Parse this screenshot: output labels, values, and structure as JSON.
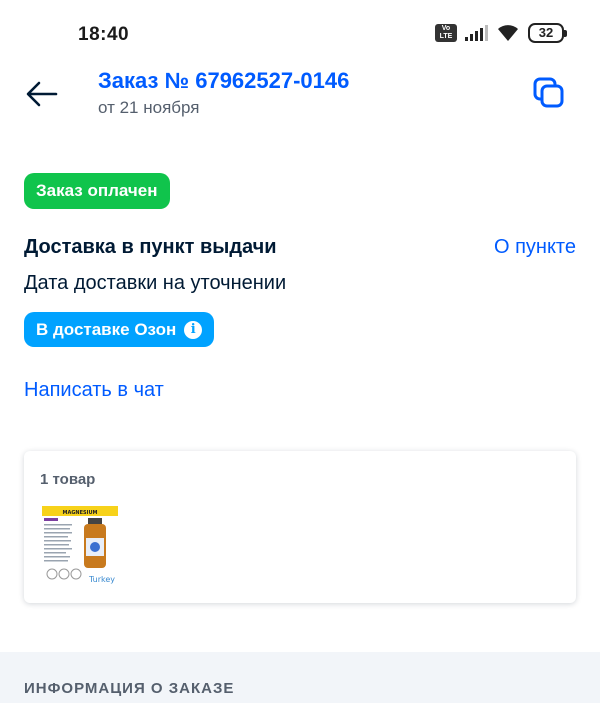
{
  "status_bar": {
    "time": "18:40",
    "battery": "32",
    "icons": [
      "volte-icon",
      "signal-icon",
      "wifi-icon",
      "battery-icon"
    ]
  },
  "header": {
    "title": "Заказ № 67962527-0146",
    "subtitle": "от 21 ноября"
  },
  "order": {
    "status_badge": "Заказ оплачен",
    "delivery_title": "Доставка в пункт выдачи",
    "about_link": "О пункте",
    "delivery_date": "Дата доставки на уточнении",
    "shipping_badge": "В доставке Озон",
    "chat_link": "Написать в чат"
  },
  "items": {
    "count_label": "1 товар",
    "product_image_text": {
      "header": "MAGNESIUM",
      "brand": "Turkey"
    }
  },
  "info_section": {
    "title": "ИНФОРМАЦИЯ О ЗАКАЗЕ"
  },
  "colors": {
    "primary": "#005bff",
    "paid": "#10c44c",
    "ozon": "#00a2ff",
    "text": "#001a34"
  }
}
